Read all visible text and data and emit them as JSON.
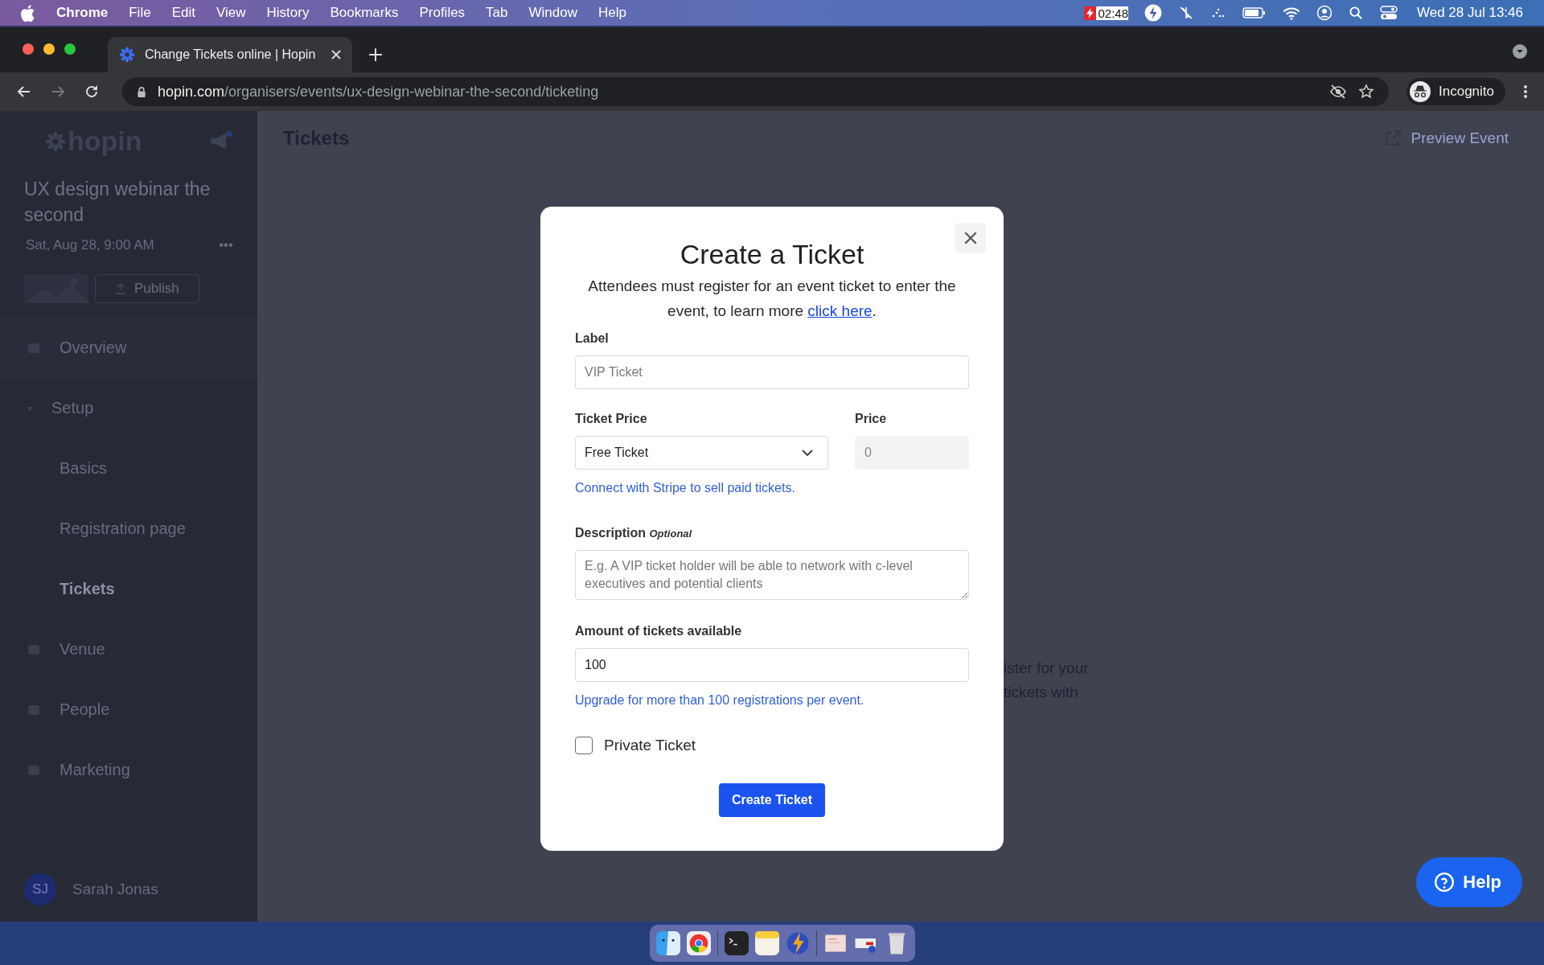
{
  "menubar": {
    "app": "Chrome",
    "menus": [
      "File",
      "Edit",
      "View",
      "History",
      "Bookmarks",
      "Profiles",
      "Tab",
      "Window",
      "Help"
    ],
    "timer": "02:48",
    "clock": "Wed 28 Jul  13:46"
  },
  "browser": {
    "tab_title": "Change Tickets online | Hopin",
    "url_host": "hopin.com",
    "url_path": "/organisers/events/ux-design-webinar-the-second/ticketing",
    "profile": "Incognito"
  },
  "sidebar": {
    "logo": "hopin",
    "event_title": "UX design webinar the second",
    "event_date": "Sat, Aug 28, 9:00 AM",
    "more": "•••",
    "publish": "Publish",
    "nav": [
      {
        "label": "Overview",
        "kind": "item",
        "selected": false
      },
      {
        "label": "Setup",
        "kind": "group",
        "expanded": true,
        "selected": false,
        "children": [
          {
            "label": "Basics",
            "selected": false
          },
          {
            "label": "Registration page",
            "selected": false
          },
          {
            "label": "Tickets",
            "selected": true
          }
        ]
      },
      {
        "label": "Venue",
        "kind": "item",
        "selected": false
      },
      {
        "label": "People",
        "kind": "item",
        "selected": false
      },
      {
        "label": "Marketing",
        "kind": "item",
        "selected": false
      }
    ],
    "user": {
      "initials": "SJ",
      "name": "Sarah Jonas"
    }
  },
  "page": {
    "title": "Tickets",
    "preview": "Preview Event",
    "fragments": [
      "ister for your",
      "tickets with"
    ]
  },
  "modal": {
    "title": "Create a Ticket",
    "intro": "Attendees must register for an event ticket to enter the event, to learn more ",
    "intro_link": "click here",
    "intro_end": ".",
    "label_field": {
      "label": "Label",
      "placeholder": "VIP Ticket"
    },
    "ticket_price": {
      "label": "Ticket Price",
      "value": "Free Ticket"
    },
    "price": {
      "label": "Price",
      "value": "0",
      "disabled": true
    },
    "stripe_hint": "Connect with Stripe to sell paid tickets.",
    "description": {
      "label": "Description",
      "optional": "Optional",
      "placeholder": "E.g. A VIP ticket holder will be able to network with c-level executives and potential clients"
    },
    "amount": {
      "label": "Amount of tickets available",
      "value": "100"
    },
    "upgrade_hint": "Upgrade for more than 100 registrations per event.",
    "private": {
      "label": "Private Ticket",
      "checked": false
    },
    "submit": "Create Ticket"
  },
  "help_button": "Help"
}
